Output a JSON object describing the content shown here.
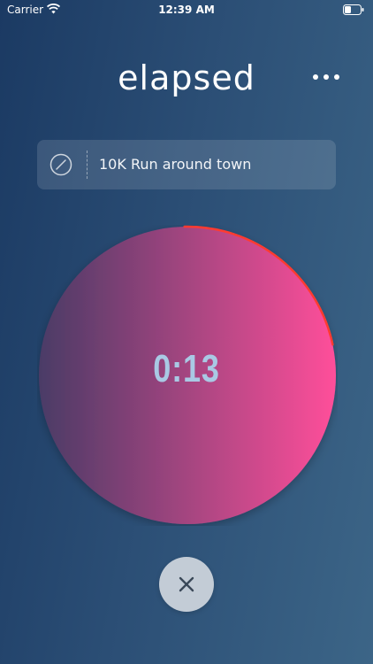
{
  "status_bar": {
    "carrier": "Carrier",
    "time": "12:39 AM",
    "wifi_icon": "wifi-icon",
    "battery_icon": "battery-icon"
  },
  "header": {
    "title": "elapsed",
    "more_icon": "more-horizontal-icon"
  },
  "task": {
    "icon": "compass-icon",
    "label": "10K Run around town"
  },
  "timer": {
    "value": "0:13",
    "progress_fraction": 0.22,
    "gradient_start": "#4a3b66",
    "gradient_end": "#ff4f9a",
    "progress_color": "#ff3b30"
  },
  "actions": {
    "close_icon": "close-icon"
  }
}
